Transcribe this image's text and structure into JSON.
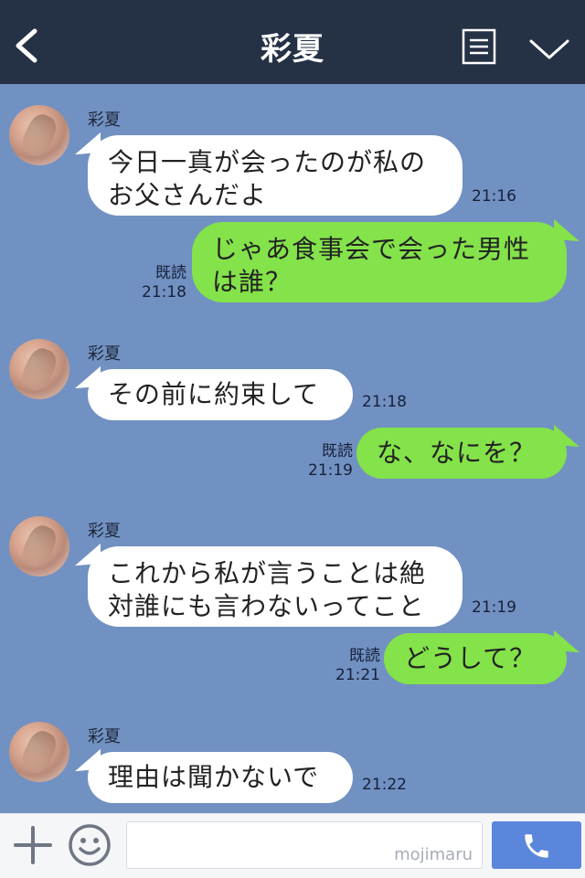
{
  "header": {
    "title": "彩夏",
    "back_icon": "chevron-left-icon",
    "menu_icon": "menu-icon",
    "expand_icon": "chevron-down-icon"
  },
  "messages": [
    {
      "side": "in",
      "sender": "彩夏",
      "lines": [
        "今日一真が会ったのが私の",
        "お父さんだよ"
      ],
      "time": "21:16"
    },
    {
      "side": "out",
      "read": "既読",
      "lines": [
        "じゃあ食事会で会った男性",
        "は誰？"
      ],
      "time": "21:18"
    },
    {
      "side": "in",
      "sender": "彩夏",
      "lines": [
        "その前に約束して"
      ],
      "time": "21:18"
    },
    {
      "side": "out",
      "read": "既読",
      "lines": [
        "な、なにを？"
      ],
      "time": "21:19"
    },
    {
      "side": "in",
      "sender": "彩夏",
      "lines": [
        "これから私が言うことは絶",
        "対誰にも言わないってこと"
      ],
      "time": "21:19"
    },
    {
      "side": "out",
      "read": "既読",
      "lines": [
        "どうして？"
      ],
      "time": "21:21"
    },
    {
      "side": "in",
      "sender": "彩夏",
      "lines": [
        "理由は聞かないで"
      ],
      "time": "21:22"
    }
  ],
  "footer": {
    "plus_icon": "plus-icon",
    "emoji_icon": "smile-icon",
    "input_value": "",
    "watermark": "mojimaru",
    "call_icon": "phone-icon"
  },
  "colors": {
    "header_bg": "#253145",
    "chat_bg": "#7191c2",
    "incoming_bubble": "#ffffff",
    "outgoing_bubble": "#84e24a",
    "call_button": "#5a86dc"
  }
}
